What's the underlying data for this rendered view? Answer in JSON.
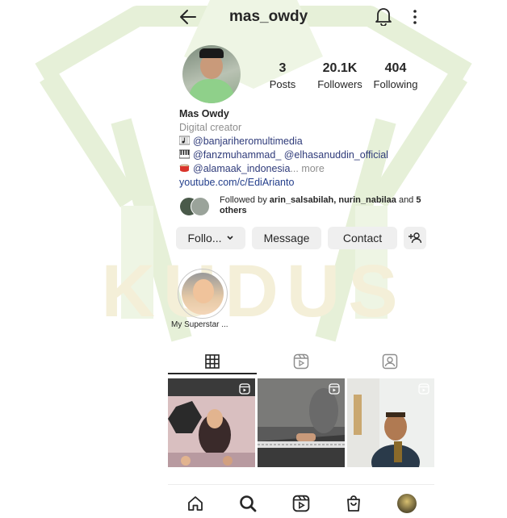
{
  "header": {
    "username": "mas_owdy"
  },
  "stats": [
    {
      "value": "3",
      "label": "Posts"
    },
    {
      "value": "20.1K",
      "label": "Followers"
    },
    {
      "value": "404",
      "label": "Following"
    }
  ],
  "bio": {
    "name": "Mas Owdy",
    "category": "Digital creator",
    "line1": "@banjariheromultimedia",
    "line2": "@fanzmuhammad_ @elhasanuddin_official",
    "line3": "@alamaak_indonesia",
    "line3_ellipsis": "...",
    "more": "more",
    "link": "youtube.com/c/EdiArianto"
  },
  "followed_by": {
    "prefix": "Followed by ",
    "names": "arin_salsabilah, nurin_nabilaa",
    "connector": " and ",
    "others": "5 others"
  },
  "buttons": {
    "follow": "Follo...",
    "message": "Message",
    "contact": "Contact"
  },
  "highlights": [
    {
      "label": "My Superstar ..."
    }
  ],
  "icons": {
    "back": "arrow-left-icon",
    "bell": "bell-icon",
    "menu": "more-vertical-icon",
    "add_person": "add-person-icon",
    "grid": "grid-icon",
    "reels": "reels-icon",
    "tagged": "tagged-icon",
    "home": "home-icon",
    "search": "search-icon",
    "shop": "shop-bag-icon"
  },
  "watermark_text": "KUDUS",
  "colors": {
    "watermark": "#e9f1dc",
    "accent_link": "#233e8b",
    "button_bg": "#efefef"
  }
}
